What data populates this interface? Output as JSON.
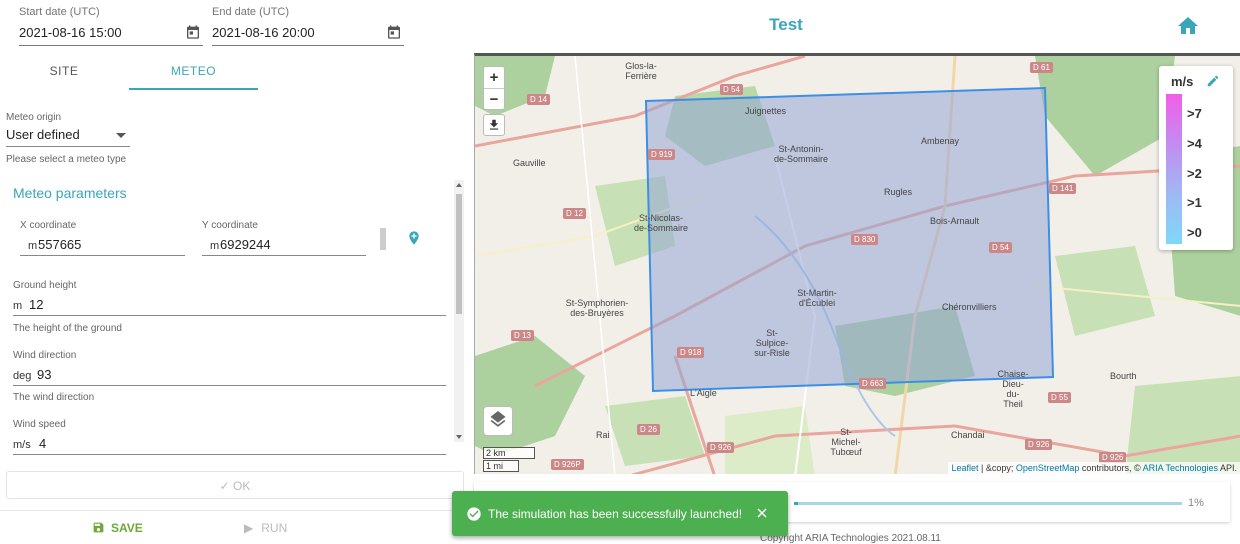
{
  "header": {
    "start_date_label": "Start date (UTC)",
    "start_date_value": "2021-08-16 15:00",
    "end_date_label": "End date (UTC)",
    "end_date_value": "2021-08-16 20:00",
    "title": "Test",
    "calendar_icon": "calendar-icon",
    "home_icon": "home-icon"
  },
  "tabs": [
    {
      "label": "SITE",
      "active": false
    },
    {
      "label": "METEO",
      "active": true
    }
  ],
  "meteo_origin": {
    "label": "Meteo origin",
    "value": "User defined",
    "hint": "Please select a meteo type"
  },
  "meteo_params": {
    "title": "Meteo parameters",
    "x_label": "X coordinate",
    "x_unit": "m",
    "x_value": "557665",
    "y_label": "Y coordinate",
    "y_unit": "m",
    "y_value": "6929244",
    "ground_label": "Ground height",
    "ground_unit": "m",
    "ground_value": "12",
    "ground_hint": "The height of the ground",
    "wind_dir_label": "Wind direction",
    "wind_dir_unit": "deg",
    "wind_dir_value": "93",
    "wind_dir_hint": "The wind direction",
    "wind_speed_label": "Wind speed",
    "wind_speed_unit": "m/s",
    "wind_speed_value": "4"
  },
  "buttons": {
    "ok": "OK",
    "save": "SAVE",
    "run": "RUN"
  },
  "map": {
    "zoom_in": "+",
    "zoom_out": "−",
    "scale_km": "2 km",
    "scale_mi": "1 mi",
    "legend_unit": "m/s",
    "legend_levels": [
      ">7",
      ">4",
      ">2",
      ">1",
      ">0"
    ],
    "legend_colors": [
      "#f25ee8",
      "#c28cf0",
      "#9fb8f5",
      "#7ed8f8"
    ],
    "attribution_leaflet": "Leaflet",
    "attribution_mid": " | &copy; ",
    "attribution_osm": "OpenStreetMap",
    "attribution_tail": " contributors, © ",
    "attribution_aria": "ARIA Technologies",
    "attribution_end": " API.",
    "places": [
      "Glos-la-Ferrière",
      "Juignettes",
      "St-Antonin-de-Sommaire",
      "Ambenay",
      "Gauville",
      "Rugles",
      "St-Nicolas-de-Sommaire",
      "Bois-Arnault",
      "St-Symphorien-des-Bruyères",
      "St-Martin-d'Écublei",
      "Chéronvilliers",
      "St-Sulpice-sur-Risle",
      "L'Aigle",
      "Chaise-Dieu-du-Theil",
      "Bourth",
      "Rai",
      "St-Michel-Tubœuf",
      "Chandai"
    ],
    "roads": [
      "D 61",
      "D 14",
      "D 54",
      "D 919",
      "D 12",
      "D 830",
      "D 141",
      "D 54",
      "D 13",
      "D 918",
      "D 663",
      "D 55",
      "D 26",
      "D 926",
      "D 926P",
      "D 926",
      "D 926"
    ]
  },
  "progress": {
    "percent_label": "1%",
    "percent": 1
  },
  "toast": {
    "message": "The simulation has been successfully launched!"
  },
  "footer": {
    "copyright": "Copyright ARIA Technologies 2021.08.11"
  }
}
